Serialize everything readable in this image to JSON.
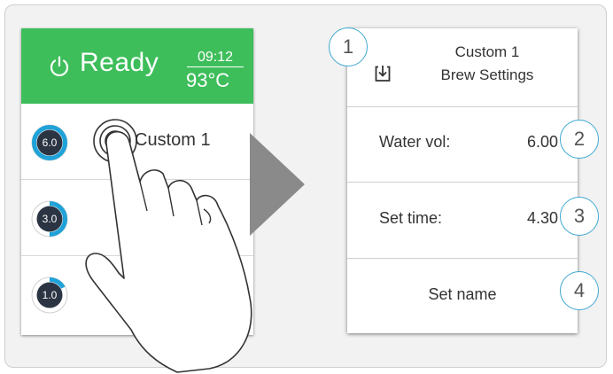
{
  "status": {
    "state": "Ready",
    "time": "09:12",
    "temperature": "93°C",
    "icon": "power-icon"
  },
  "brews": [
    {
      "volume": "6.0",
      "label": "Custom 1",
      "fill": 1.0
    },
    {
      "volume": "3.0",
      "label": "",
      "fill": 0.5
    },
    {
      "volume": "1.0",
      "label": "",
      "fill": 0.17
    }
  ],
  "settings": {
    "title_line1": "Custom 1",
    "title_line2": "Brew Settings",
    "save_icon": "save-icon",
    "water_vol_label": "Water vol:",
    "water_vol_value": "6.00",
    "set_time_label": "Set time:",
    "set_time_value": "4.30",
    "set_name_label": "Set name"
  },
  "callouts": [
    "1",
    "2",
    "3",
    "4"
  ],
  "colors": {
    "status_green": "#3ebe5b",
    "gauge_blue": "#1fa2d8",
    "gauge_dark": "#2b3443",
    "callout_border": "#3fa9d1"
  }
}
